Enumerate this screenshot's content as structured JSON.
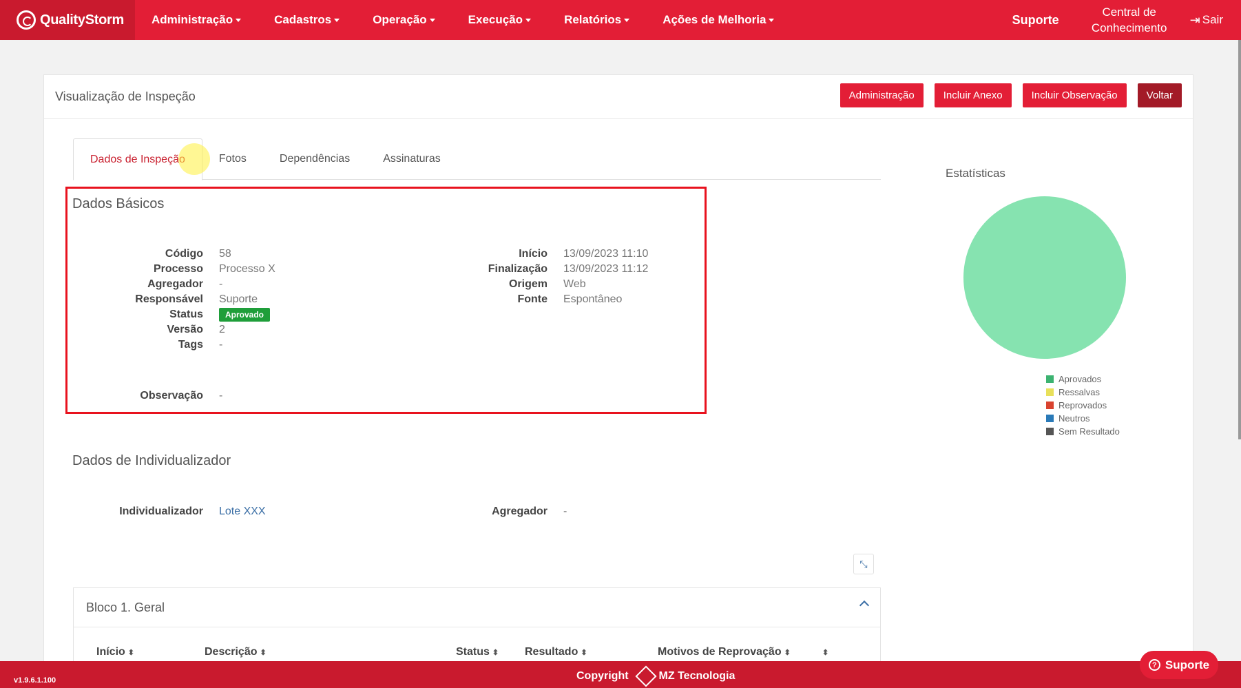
{
  "brand": {
    "name": "QualityStorm"
  },
  "nav": {
    "items": [
      {
        "label": "Administração"
      },
      {
        "label": "Cadastros"
      },
      {
        "label": "Operação"
      },
      {
        "label": "Execução"
      },
      {
        "label": "Relatórios"
      },
      {
        "label": "Ações de Melhoria"
      }
    ],
    "suporte": "Suporte",
    "central_line1": "Central de",
    "central_line2": "Conhecimento",
    "sair": "Sair"
  },
  "page": {
    "title": "Visualização de Inspeção",
    "buttons": {
      "administracao": "Administração",
      "incluir_anexo": "Incluir Anexo",
      "incluir_observacao": "Incluir Observação",
      "voltar": "Voltar"
    }
  },
  "tabs": [
    {
      "label": "Dados de Inspeção",
      "active": true
    },
    {
      "label": "Fotos"
    },
    {
      "label": "Dependências"
    },
    {
      "label": "Assinaturas"
    }
  ],
  "dados_basicos": {
    "title": "Dados Básicos",
    "left": [
      {
        "label": "Código",
        "value": "58"
      },
      {
        "label": "Processo",
        "value": "Processo X"
      },
      {
        "label": "Agregador",
        "value": "-"
      },
      {
        "label": "Responsável",
        "value": "Suporte"
      },
      {
        "label": "Status",
        "value": "Aprovado"
      },
      {
        "label": "Versão",
        "value": "2"
      },
      {
        "label": "Tags",
        "value": "-"
      }
    ],
    "right": [
      {
        "label": "Início",
        "value": "13/09/2023 11:10"
      },
      {
        "label": "Finalização",
        "value": "13/09/2023 11:12"
      },
      {
        "label": "Origem",
        "value": "Web"
      },
      {
        "label": "Fonte",
        "value": "Espontâneo"
      }
    ],
    "observacao": {
      "label": "Observação",
      "value": "-"
    }
  },
  "individualizador": {
    "title": "Dados de Individualizador",
    "individualizador_label": "Individualizador",
    "individualizador_value": "Lote XXX",
    "agregador_label": "Agregador",
    "agregador_value": "-"
  },
  "estatisticas": {
    "title": "Estatísticas",
    "legend": [
      {
        "label": "Aprovados",
        "color": "#3cb371"
      },
      {
        "label": "Ressalvas",
        "color": "#e8e05a"
      },
      {
        "label": "Reprovados",
        "color": "#d9432f"
      },
      {
        "label": "Neutros",
        "color": "#2a7ab8"
      },
      {
        "label": "Sem Resultado",
        "color": "#555555"
      }
    ],
    "pie_color": "#86e3b0"
  },
  "bloco": {
    "title": "Bloco 1. Geral",
    "columns": [
      "Início",
      "Descrição",
      "Status",
      "Resultado",
      "Motivos de Reprovação"
    ]
  },
  "footer": {
    "version": "v1.9.6.1.100",
    "copyright": "Copyright",
    "company": "MZ Tecnologia",
    "help": "Suporte"
  }
}
